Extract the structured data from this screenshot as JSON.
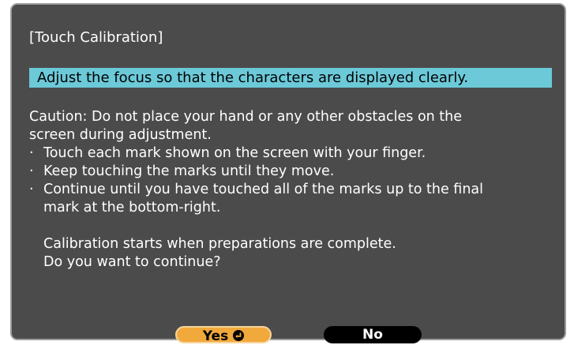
{
  "dialog": {
    "title": "[Touch Calibration]",
    "highlight": "Adjust the focus so that the characters are displayed clearly.",
    "caution_line1": "Caution: Do not place your hand or any other obstacles on the",
    "caution_line2": "screen during adjustment.",
    "bullet_symbol": "·",
    "bullets": [
      "Touch each mark shown on the screen with your finger.",
      "Keep touching the marks until they move.",
      "Continue until you have touched all of the marks up to the final"
    ],
    "bullet3_continued": "mark at the bottom-right.",
    "start_line": "Calibration starts when preparations are complete.",
    "question": "Do you want to continue?"
  },
  "buttons": {
    "yes_label": "Yes",
    "yes_icon": "enter-key-icon",
    "no_label": "No"
  },
  "colors": {
    "dialog_background": "#4b4b4b",
    "highlight_background": "#6cc9d8",
    "yes_button": "#f2a93c",
    "no_button": "#000000",
    "text": "#ffffff"
  }
}
